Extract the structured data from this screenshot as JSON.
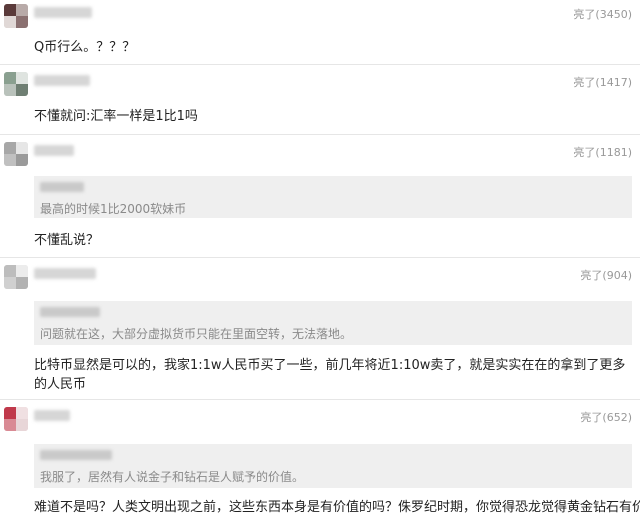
{
  "comments": [
    {
      "likes": "亮了(3450)",
      "text": "Q币行么。？？？"
    },
    {
      "likes": "亮了(1417)",
      "text": "不懂就问:汇率一样是1比1吗"
    },
    {
      "likes": "亮了(1181)",
      "quote": "最高的时候1比2000软妹币",
      "text": "不懂乱说？"
    },
    {
      "likes": "亮了(904)",
      "quote": "问题就在这，大部分虚拟货币只能在里面空转，无法落地。",
      "text": "比特币显然是可以的，我家1:1w人民币买了一些，前几年将近1:10w卖了，就是实实在在的拿到了更多的人民币"
    },
    {
      "likes": "亮了(652)",
      "quote": "我服了，居然有人说金子和钻石是人赋予的价值。",
      "text": "难道不是吗？人类文明出现之前，这些东西本身是有价值的吗？侏罗纪时期，你觉得恐龙觉得黄金钻石有价"
    }
  ]
}
